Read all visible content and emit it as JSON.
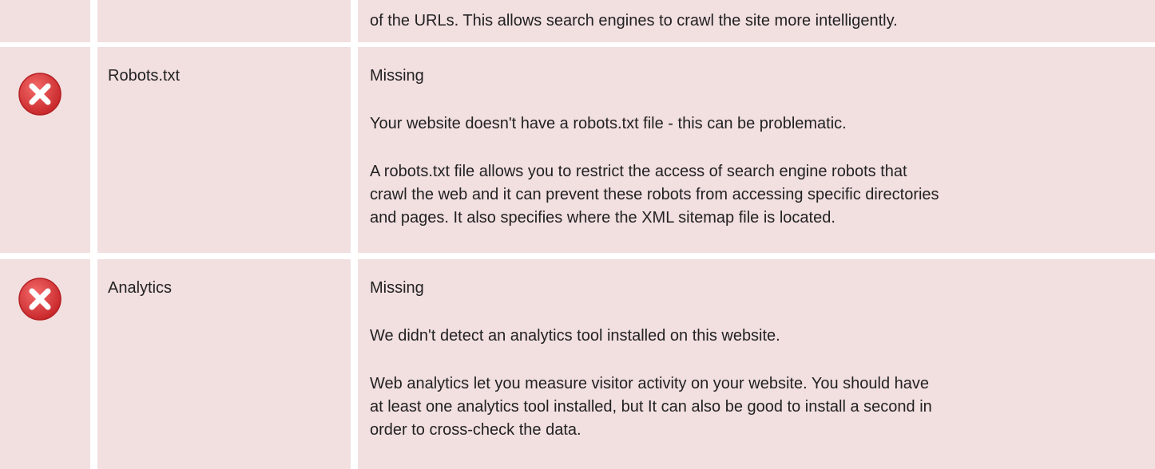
{
  "rows": [
    {
      "description": [
        "of the URLs. This allows search engines to crawl the site more intelligently."
      ]
    },
    {
      "status_icon": "error-x-icon",
      "name": "Robots.txt",
      "status": "Missing",
      "description": [
        "Your website doesn't have a robots.txt file - this can be problematic.",
        "A robots.txt file allows you to restrict the access of search engine robots that",
        "crawl the web and it can prevent these robots from accessing specific directories",
        "and pages. It also specifies where the XML sitemap file is located."
      ]
    },
    {
      "status_icon": "error-x-icon",
      "name": "Analytics",
      "status": "Missing",
      "description": [
        "We didn't detect an analytics tool installed on this website.",
        "Web analytics let you measure visitor activity on your website. You should have",
        "at least one analytics tool installed, but It can also be good to install a second in",
        "order to cross-check the data."
      ]
    }
  ],
  "colors": {
    "row_background": "#f2dfe0",
    "separator": "#ffffff",
    "error_red": "#e0393b",
    "text": "#222222"
  }
}
